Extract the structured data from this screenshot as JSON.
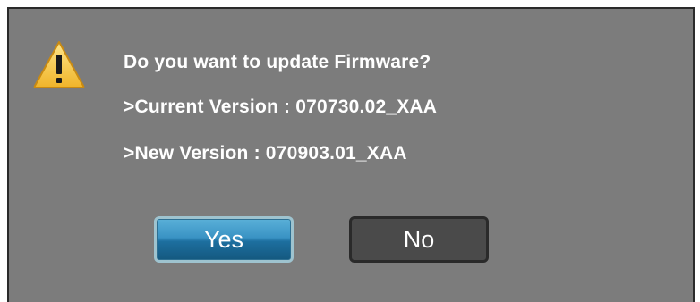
{
  "dialog": {
    "icon": "warning-icon",
    "question": "Do you want to update Firmware?",
    "current_version": ">Current Version : 070730.02_XAA",
    "new_version": ">New Version : 070903.01_XAA"
  },
  "buttons": {
    "yes_label": "Yes",
    "no_label": "No"
  },
  "colors": {
    "dialog_bg": "#7c7c7c",
    "selected_button": "#3a93c4",
    "unselected_button": "#4a4a4a",
    "warning_yellow": "#f5c842"
  }
}
